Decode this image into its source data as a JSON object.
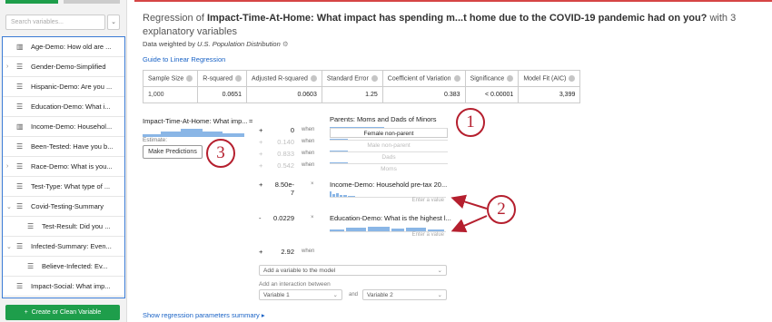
{
  "sidebar": {
    "search_placeholder": "Search variables...",
    "create_button": "Create or Clean Variable",
    "items": [
      {
        "label": "Age-Demo: How old are ...",
        "icon": "bar-chart-icon",
        "expand": ""
      },
      {
        "label": "Gender-Demo-Simplified",
        "icon": "list-icon",
        "expand": "›"
      },
      {
        "label": "Hispanic-Demo: Are you ...",
        "icon": "list-icon",
        "expand": ""
      },
      {
        "label": "Education-Demo: What i...",
        "icon": "list-icon",
        "expand": ""
      },
      {
        "label": "Income-Demo: Househol...",
        "icon": "bar-chart-icon",
        "expand": ""
      },
      {
        "label": "Been-Tested: Have you b...",
        "icon": "list-icon",
        "expand": ""
      },
      {
        "label": "Race-Demo: What is you...",
        "icon": "list-icon",
        "expand": "›"
      },
      {
        "label": "Test-Type: What type of ...",
        "icon": "list-icon",
        "expand": ""
      },
      {
        "label": "Covid-Testing-Summary",
        "icon": "list-icon",
        "expand": "⌄"
      },
      {
        "label": "Test-Result: Did you ...",
        "icon": "list-icon",
        "expand": "",
        "indent": true
      },
      {
        "label": "Infected-Summary: Even...",
        "icon": "list-icon",
        "expand": "⌄"
      },
      {
        "label": "Believe-Infected: Ev...",
        "icon": "list-icon",
        "expand": "",
        "indent": true
      },
      {
        "label": "Impact-Social: What imp...",
        "icon": "list-icon",
        "expand": ""
      }
    ]
  },
  "header": {
    "title_prefix": "Regression of ",
    "title_bold": "Impact-Time-At-Home: What impact has spending m...t home due to the COVID-19 pandemic had on you?",
    "title_suffix": " with 3 explanatory variables",
    "weight_prefix": "Data weighted by ",
    "weight_name": "U.S. Population Distribution",
    "guide_link": "Guide to Linear Regression"
  },
  "stats": {
    "headers": [
      "Sample Size",
      "R-squared",
      "Adjusted R-squared",
      "Standard Error",
      "Coefficient of Variation",
      "Significance",
      "Model Fit (AIC)"
    ],
    "values": [
      "1,000",
      "0.0651",
      "0.0603",
      "1.25",
      "0.383",
      "< 0.00001",
      "3,399"
    ]
  },
  "equation": {
    "lhs": "Impact-Time-At-Home: What imp...",
    "equals": "=",
    "estimate_label": "Estimate:",
    "make_predictions": "Make Predictions",
    "when": "when",
    "parents_label": "Parents: Moms and Dads of Minors",
    "parent_terms": [
      {
        "sign": "+",
        "coef": "0",
        "cat": "Female non-parent"
      },
      {
        "sign": "+",
        "coef": "0.140",
        "cat": "Male non-parent"
      },
      {
        "sign": "+",
        "coef": "0.833",
        "cat": "Dads"
      },
      {
        "sign": "+",
        "coef": "0.542",
        "cat": "Moms"
      }
    ],
    "income": {
      "sign": "+",
      "coef": "8.50e-7",
      "times": "×",
      "label": "Income-Demo: Household pre-tax 20...",
      "placeholder": "Enter a value"
    },
    "education": {
      "sign": "-",
      "coef": "0.0229",
      "times": "×",
      "label": "Education-Demo: What is the highest l...",
      "placeholder": "Enter a value"
    },
    "intercept": {
      "sign": "+",
      "coef": "2.92",
      "when": "when"
    },
    "add_variable": "Add a variable to the model",
    "interaction_label": "Add an interaction between",
    "var1": "Variable 1",
    "and": "and",
    "var2": "Variable 2"
  },
  "callouts": [
    "1",
    "2",
    "3"
  ],
  "footer_link": "Show regression parameters summary ▸",
  "colors": {
    "accent": "#1a63c6",
    "create": "#1e9e4b",
    "callout": "#b51f2e",
    "bar": "#8ab6e6"
  }
}
